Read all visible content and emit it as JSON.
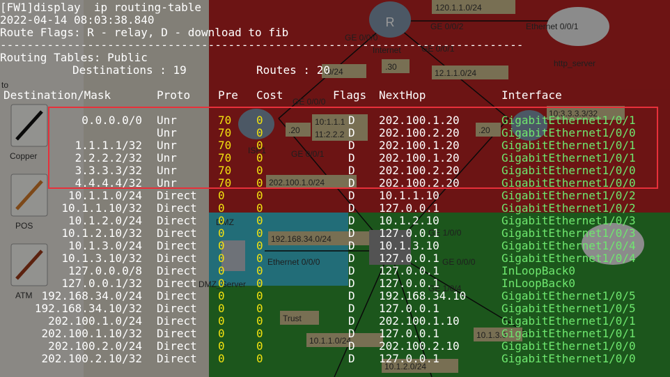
{
  "colors": {
    "text_white": "#ffffff",
    "text_yellow": "#f2e20f",
    "text_green": "#6fe86f",
    "highlight_border": "#e8303a",
    "zone_red": "#b52222",
    "zone_cyan": "#39b6c9",
    "zone_green": "#2f8f2f"
  },
  "terminal": {
    "command": "[FW1]display  ip routing-table",
    "timestamp": "2022-04-14 08:03:38.840",
    "flags_line": "Route Flags: R - relay, D - download to fib",
    "separator": "------------------------------------------------------------------------------",
    "table_title": "Routing Tables: Public",
    "destinations_label": "Destinations : 19",
    "routes_label": "Routes : 20",
    "headers": {
      "destination": "Destination/Mask",
      "proto": "Proto",
      "pre": "Pre",
      "cost": "Cost",
      "flags": "Flags",
      "nexthop": "NextHop",
      "interface": "Interface"
    },
    "routes": [
      {
        "dest": "0.0.0.0/0",
        "proto": "Unr",
        "pre": "70",
        "cost": "0",
        "flags": "D",
        "nexthop": "202.100.1.20",
        "iface": "GigabitEthernet1/0/1"
      },
      {
        "dest": "",
        "proto": "Unr",
        "pre": "70",
        "cost": "0",
        "flags": "D",
        "nexthop": "202.100.2.20",
        "iface": "GigabitEthernet1/0/0"
      },
      {
        "dest": "1.1.1.1/32",
        "proto": "Unr",
        "pre": "70",
        "cost": "0",
        "flags": "D",
        "nexthop": "202.100.1.20",
        "iface": "GigabitEthernet1/0/1"
      },
      {
        "dest": "2.2.2.2/32",
        "proto": "Unr",
        "pre": "70",
        "cost": "0",
        "flags": "D",
        "nexthop": "202.100.1.20",
        "iface": "GigabitEthernet1/0/1"
      },
      {
        "dest": "3.3.3.3/32",
        "proto": "Unr",
        "pre": "70",
        "cost": "0",
        "flags": "D",
        "nexthop": "202.100.2.20",
        "iface": "GigabitEthernet1/0/0"
      },
      {
        "dest": "4.4.4.4/32",
        "proto": "Unr",
        "pre": "70",
        "cost": "0",
        "flags": "D",
        "nexthop": "202.100.2.20",
        "iface": "GigabitEthernet1/0/0"
      },
      {
        "dest": "10.1.1.0/24",
        "proto": "Direct",
        "pre": "0",
        "cost": "0",
        "flags": "D",
        "nexthop": "10.1.1.10",
        "iface": "GigabitEthernet1/0/2"
      },
      {
        "dest": "10.1.1.10/32",
        "proto": "Direct",
        "pre": "0",
        "cost": "0",
        "flags": "D",
        "nexthop": "127.0.0.1",
        "iface": "GigabitEthernet1/0/2"
      },
      {
        "dest": "10.1.2.0/24",
        "proto": "Direct",
        "pre": "0",
        "cost": "0",
        "flags": "D",
        "nexthop": "10.1.2.10",
        "iface": "GigabitEthernet1/0/3"
      },
      {
        "dest": "10.1.2.10/32",
        "proto": "Direct",
        "pre": "0",
        "cost": "0",
        "flags": "D",
        "nexthop": "127.0.0.1",
        "iface": "GigabitEthernet1/0/3"
      },
      {
        "dest": "10.1.3.0/24",
        "proto": "Direct",
        "pre": "0",
        "cost": "0",
        "flags": "D",
        "nexthop": "10.1.3.10",
        "iface": "GigabitEthernet1/0/4"
      },
      {
        "dest": "10.1.3.10/32",
        "proto": "Direct",
        "pre": "0",
        "cost": "0",
        "flags": "D",
        "nexthop": "127.0.0.1",
        "iface": "GigabitEthernet1/0/4"
      },
      {
        "dest": "127.0.0.0/8",
        "proto": "Direct",
        "pre": "0",
        "cost": "0",
        "flags": "D",
        "nexthop": "127.0.0.1",
        "iface": "InLoopBack0"
      },
      {
        "dest": "127.0.0.1/32",
        "proto": "Direct",
        "pre": "0",
        "cost": "0",
        "flags": "D",
        "nexthop": "127.0.0.1",
        "iface": "InLoopBack0"
      },
      {
        "dest": "192.168.34.0/24",
        "proto": "Direct",
        "pre": "0",
        "cost": "0",
        "flags": "D",
        "nexthop": "192.168.34.10",
        "iface": "GigabitEthernet1/0/5"
      },
      {
        "dest": "192.168.34.10/32",
        "proto": "Direct",
        "pre": "0",
        "cost": "0",
        "flags": "D",
        "nexthop": "127.0.0.1",
        "iface": "GigabitEthernet1/0/5"
      },
      {
        "dest": "202.100.1.0/24",
        "proto": "Direct",
        "pre": "0",
        "cost": "0",
        "flags": "D",
        "nexthop": "202.100.1.10",
        "iface": "GigabitEthernet1/0/1"
      },
      {
        "dest": "202.100.1.10/32",
        "proto": "Direct",
        "pre": "0",
        "cost": "0",
        "flags": "D",
        "nexthop": "127.0.0.1",
        "iface": "GigabitEthernet1/0/1"
      },
      {
        "dest": "202.100.2.0/24",
        "proto": "Direct",
        "pre": "0",
        "cost": "0",
        "flags": "D",
        "nexthop": "202.100.2.10",
        "iface": "GigabitEthernet1/0/0"
      },
      {
        "dest": "202.100.2.10/32",
        "proto": "Direct",
        "pre": "0",
        "cost": "0",
        "flags": "D",
        "nexthop": "127.0.0.1",
        "iface": "GigabitEthernet1/0/0"
      }
    ]
  },
  "background": {
    "left_panel": {
      "label_top": "to",
      "items": [
        "Copper",
        "POS",
        "ATM"
      ]
    },
    "labels": {
      "net_120": "120.1.1.0/24",
      "ge_002": "GE 0/0/2",
      "eth_001": "Ethernet 0/0/1",
      "http_server": "http_server",
      "internet": "Internet",
      "ge_001": "GE 0/0/1",
      "ge_000_a": "GE 0/0/0",
      "net_24a": ".0/24",
      "dot30": ".30",
      "net_12": "12.1.1.0/24",
      "net_3333": "10:3.3.3.3/32",
      "ge_000_b": "GE 0/0/0",
      "lo_1": "10:1.1.1",
      "lo_2": "11:2.2.2",
      "dot20a": ".20",
      "dot20b": ".20",
      "isp1": "ISP1",
      "ge_001_b": "GE 0/0/1",
      "net_202": "202.100.1.0/24",
      "dmz": "DMZ",
      "net_192": "192.168.34.0/24",
      "eth_000": "Ethernet 0/0/0",
      "dmz_server": "DMZ_Server",
      "ge_100": "GE 1/0/0",
      "ge_000_c": "GE 0/0/0",
      "ge_104": "GE 1/0/4",
      "trust": "Trust",
      "net_10a": "10.1.1.0/24",
      "net_10b": "10.1.3.0",
      "net_10c": "10.1.2.0/24"
    }
  }
}
